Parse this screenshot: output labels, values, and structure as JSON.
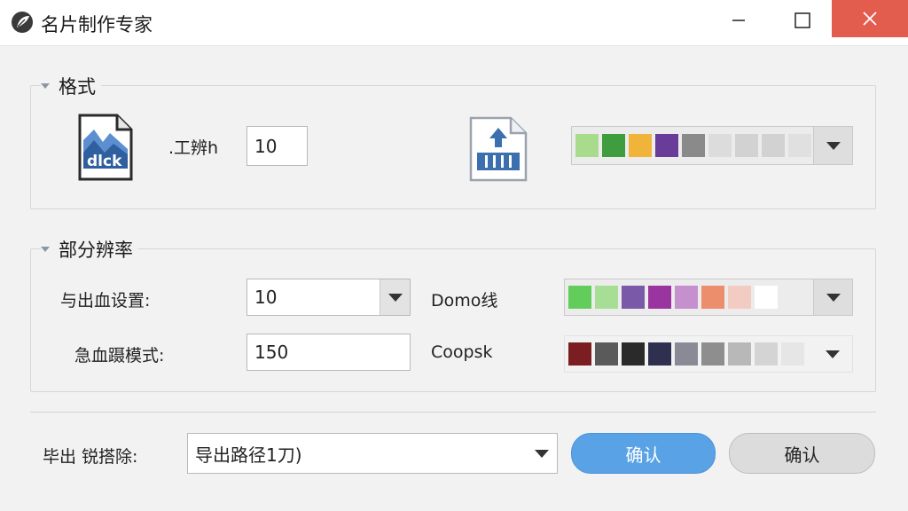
{
  "window": {
    "title": "名片制作专家",
    "accent_close": "#e35d4f"
  },
  "format_group": {
    "title": "格式",
    "file_icon_label": "dlck",
    "size_label": ".工辨h",
    "size_value": "10",
    "palette": [
      "#a8dc8c",
      "#3f9d3f",
      "#f1b43a",
      "#6a3c9a",
      "#8a8a8a",
      "#dcdcdc",
      "#d2d2d2",
      "#d2d2d2",
      "#e0e0e0"
    ]
  },
  "resolution_group": {
    "title": "部分辨率",
    "bleed_label": "与出血设置:",
    "bleed_value": "10",
    "crop_label": "急血蹑模式:",
    "crop_value": "150",
    "combo_line_label": "Domo线",
    "coopsk_label": "Coopsk",
    "palette_combo": [
      "#62cd5a",
      "#a6de96",
      "#7a5aa8",
      "#9a35a0",
      "#c68fce",
      "#ec8e6c",
      "#f2cbc2",
      "#ffffff"
    ],
    "palette_coopsk": [
      "#7a1e22",
      "#5a5a5a",
      "#2a2a2a",
      "#2f2f4f",
      "#8a8a96",
      "#8e8e8e",
      "#b8b8b8",
      "#d4d4d4",
      "#e6e6e6"
    ]
  },
  "footer": {
    "export_label": "毕出 锐搭除:",
    "export_path": "导出路径1刀)",
    "confirm_primary": "确认",
    "confirm_secondary": "确认"
  },
  "icons": {
    "app": "leaf-logo-icon",
    "file": "image-file-icon",
    "upload": "upload-document-icon",
    "minimize": "minimize-icon",
    "maximize": "maximize-icon",
    "close": "close-icon",
    "dropdown": "chevron-down-icon"
  }
}
